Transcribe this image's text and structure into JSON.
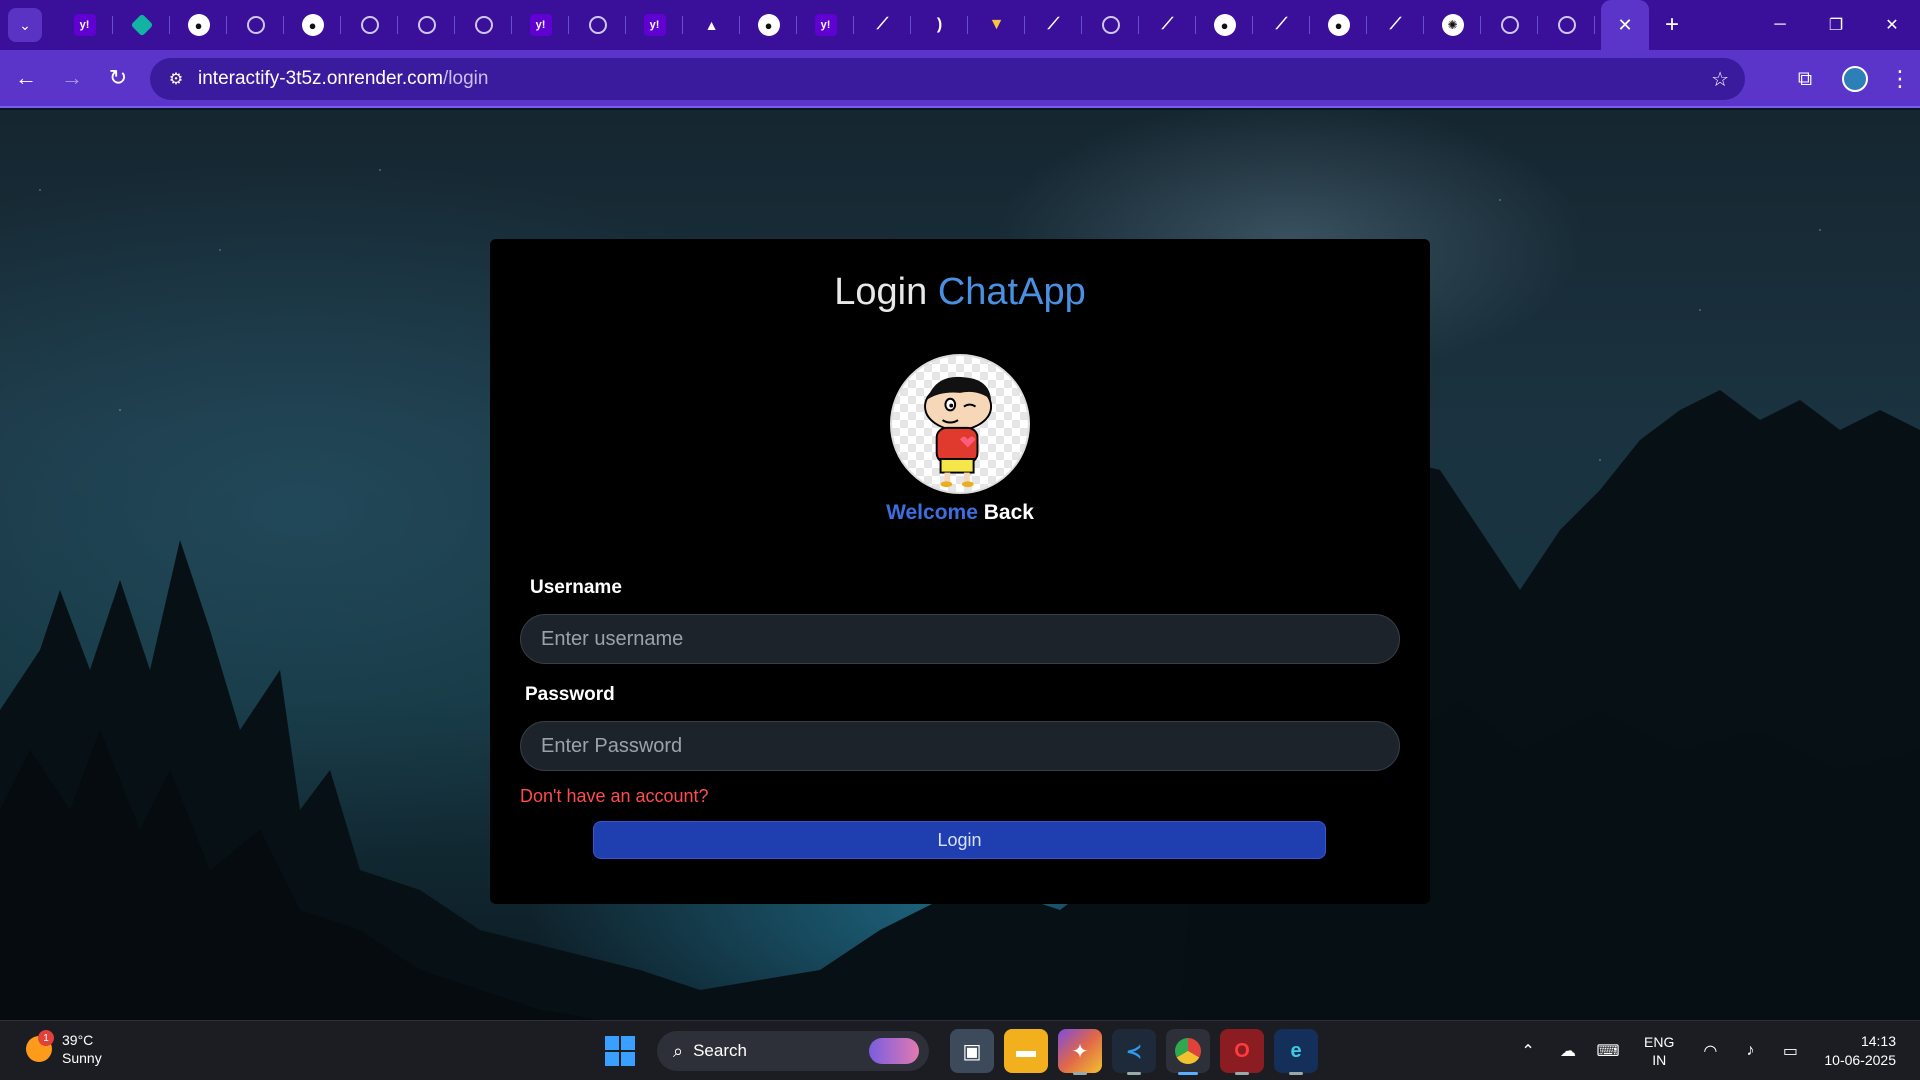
{
  "browser": {
    "url_host": "interactify-3t5z.onrender.com",
    "url_path": "/login",
    "tabs": [
      {
        "icon": "yahoo-icon",
        "glyph": "y!"
      },
      {
        "icon": "diamond-icon",
        "glyph": ""
      },
      {
        "icon": "github-icon",
        "glyph": "●"
      },
      {
        "icon": "globe-icon",
        "glyph": ""
      },
      {
        "icon": "github-icon",
        "glyph": "●"
      },
      {
        "icon": "globe-icon",
        "glyph": ""
      },
      {
        "icon": "globe-icon",
        "glyph": ""
      },
      {
        "icon": "globe-icon",
        "glyph": ""
      },
      {
        "icon": "yahoo-icon",
        "glyph": "y!"
      },
      {
        "icon": "globe-icon",
        "glyph": ""
      },
      {
        "icon": "yahoo-icon",
        "glyph": "y!"
      },
      {
        "icon": "triangle-icon",
        "glyph": "▲"
      },
      {
        "icon": "github-icon",
        "glyph": "●"
      },
      {
        "icon": "yahoo-icon",
        "glyph": "y!"
      },
      {
        "icon": "link-icon",
        "glyph": "⟋"
      },
      {
        "icon": "moon-icon",
        "glyph": ")"
      },
      {
        "icon": "vite-icon",
        "glyph": "▼"
      },
      {
        "icon": "link-icon",
        "glyph": "⟋"
      },
      {
        "icon": "globe-icon",
        "glyph": ""
      },
      {
        "icon": "link-icon",
        "glyph": "⟋"
      },
      {
        "icon": "github-icon",
        "glyph": "●"
      },
      {
        "icon": "link-icon",
        "glyph": "⟋"
      },
      {
        "icon": "github-icon",
        "glyph": "●"
      },
      {
        "icon": "link-icon",
        "glyph": "⟋"
      },
      {
        "icon": "openai-icon",
        "glyph": "✺"
      },
      {
        "icon": "globe-icon",
        "glyph": ""
      },
      {
        "icon": "globe-icon",
        "glyph": ""
      }
    ],
    "active_tab_close": "✕",
    "new_tab": "+"
  },
  "page": {
    "title_prefix": "Login",
    "title_brand": "ChatApp",
    "welcome_1": "Welcome",
    "welcome_2": "Back",
    "username_label": "Username",
    "username_placeholder": "Enter username",
    "password_label": "Password",
    "password_placeholder": "Enter Password",
    "signup_link": "Don't have an account?",
    "login_button": "Login"
  },
  "taskbar": {
    "weather_temp": "39°C",
    "weather_desc": "Sunny",
    "weather_badge": "1",
    "search_label": "Search",
    "lang_1": "ENG",
    "lang_2": "IN",
    "time": "14:13",
    "date": "10-06-2025"
  },
  "colors": {
    "tabbar": "#3a0f9a",
    "toolbar": "#5b35c9",
    "brand_blue": "#4a90e2",
    "login_button": "#1f3fb0",
    "signup_red": "#ff4c4c"
  }
}
